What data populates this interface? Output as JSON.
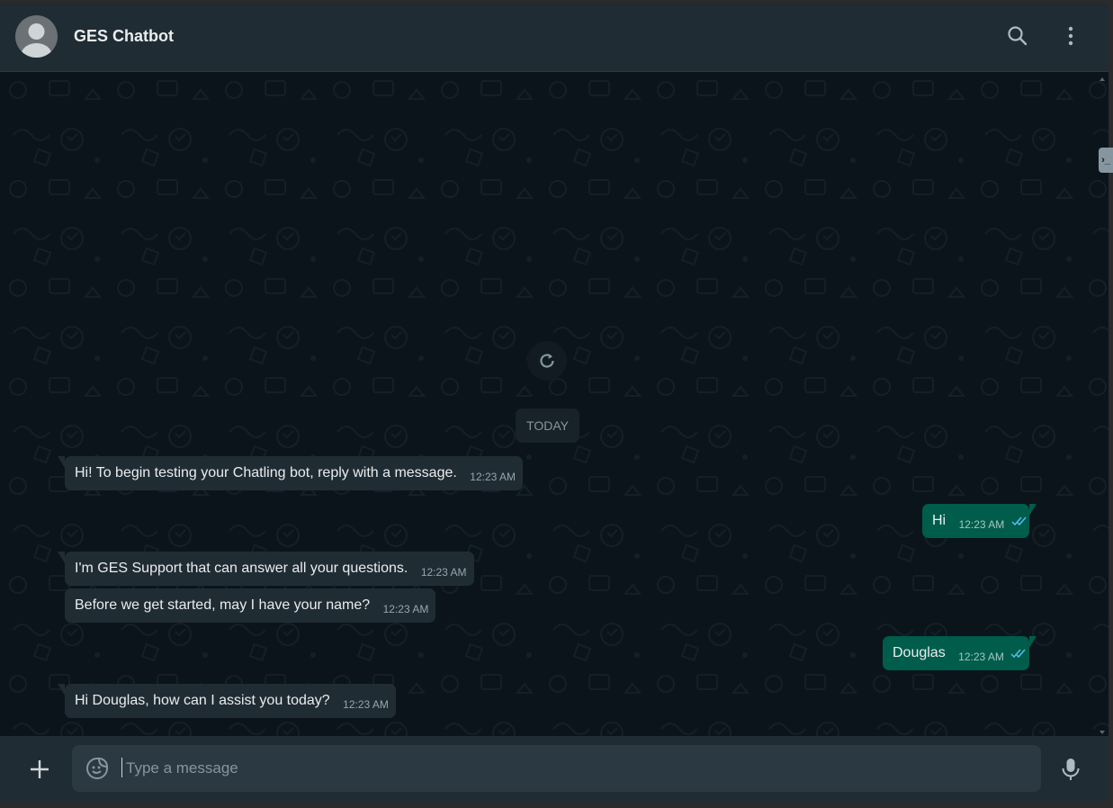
{
  "header": {
    "title": "GES Chatbot",
    "avatar_icon": "default-avatar-icon",
    "search_icon": "search-icon",
    "menu_icon": "kebab-menu-icon"
  },
  "chat": {
    "date_divider": "TODAY",
    "refresh_icon": "refresh-icon",
    "side_tab_glyph": "›_",
    "messages": [
      {
        "direction": "incoming",
        "text": "Hi! To begin testing your Chatling bot, reply with a message.",
        "time": "12:23 AM"
      },
      {
        "direction": "outgoing",
        "text": "Hi",
        "time": "12:23 AM",
        "status": "read"
      },
      {
        "direction": "incoming",
        "text": "I'm GES Support that can answer all your questions.",
        "time": "12:23 AM"
      },
      {
        "direction": "incoming",
        "text": "Before we get started, may I have your name?",
        "time": "12:23 AM"
      },
      {
        "direction": "outgoing",
        "text": "Douglas",
        "time": "12:23 AM",
        "status": "read"
      },
      {
        "direction": "incoming",
        "text": "Hi Douglas, how can I assist you today?",
        "time": "12:23 AM"
      }
    ]
  },
  "composer": {
    "placeholder": "Type a message",
    "value": "",
    "attach_icon": "plus-icon",
    "sticker_icon": "sticker-icon",
    "mic_icon": "microphone-icon"
  },
  "colors": {
    "header_bg": "#202c33",
    "chat_bg": "#0b141a",
    "incoming_bubble": "#202c33",
    "outgoing_bubble": "#005c4b",
    "read_ticks": "#53bdeb"
  }
}
